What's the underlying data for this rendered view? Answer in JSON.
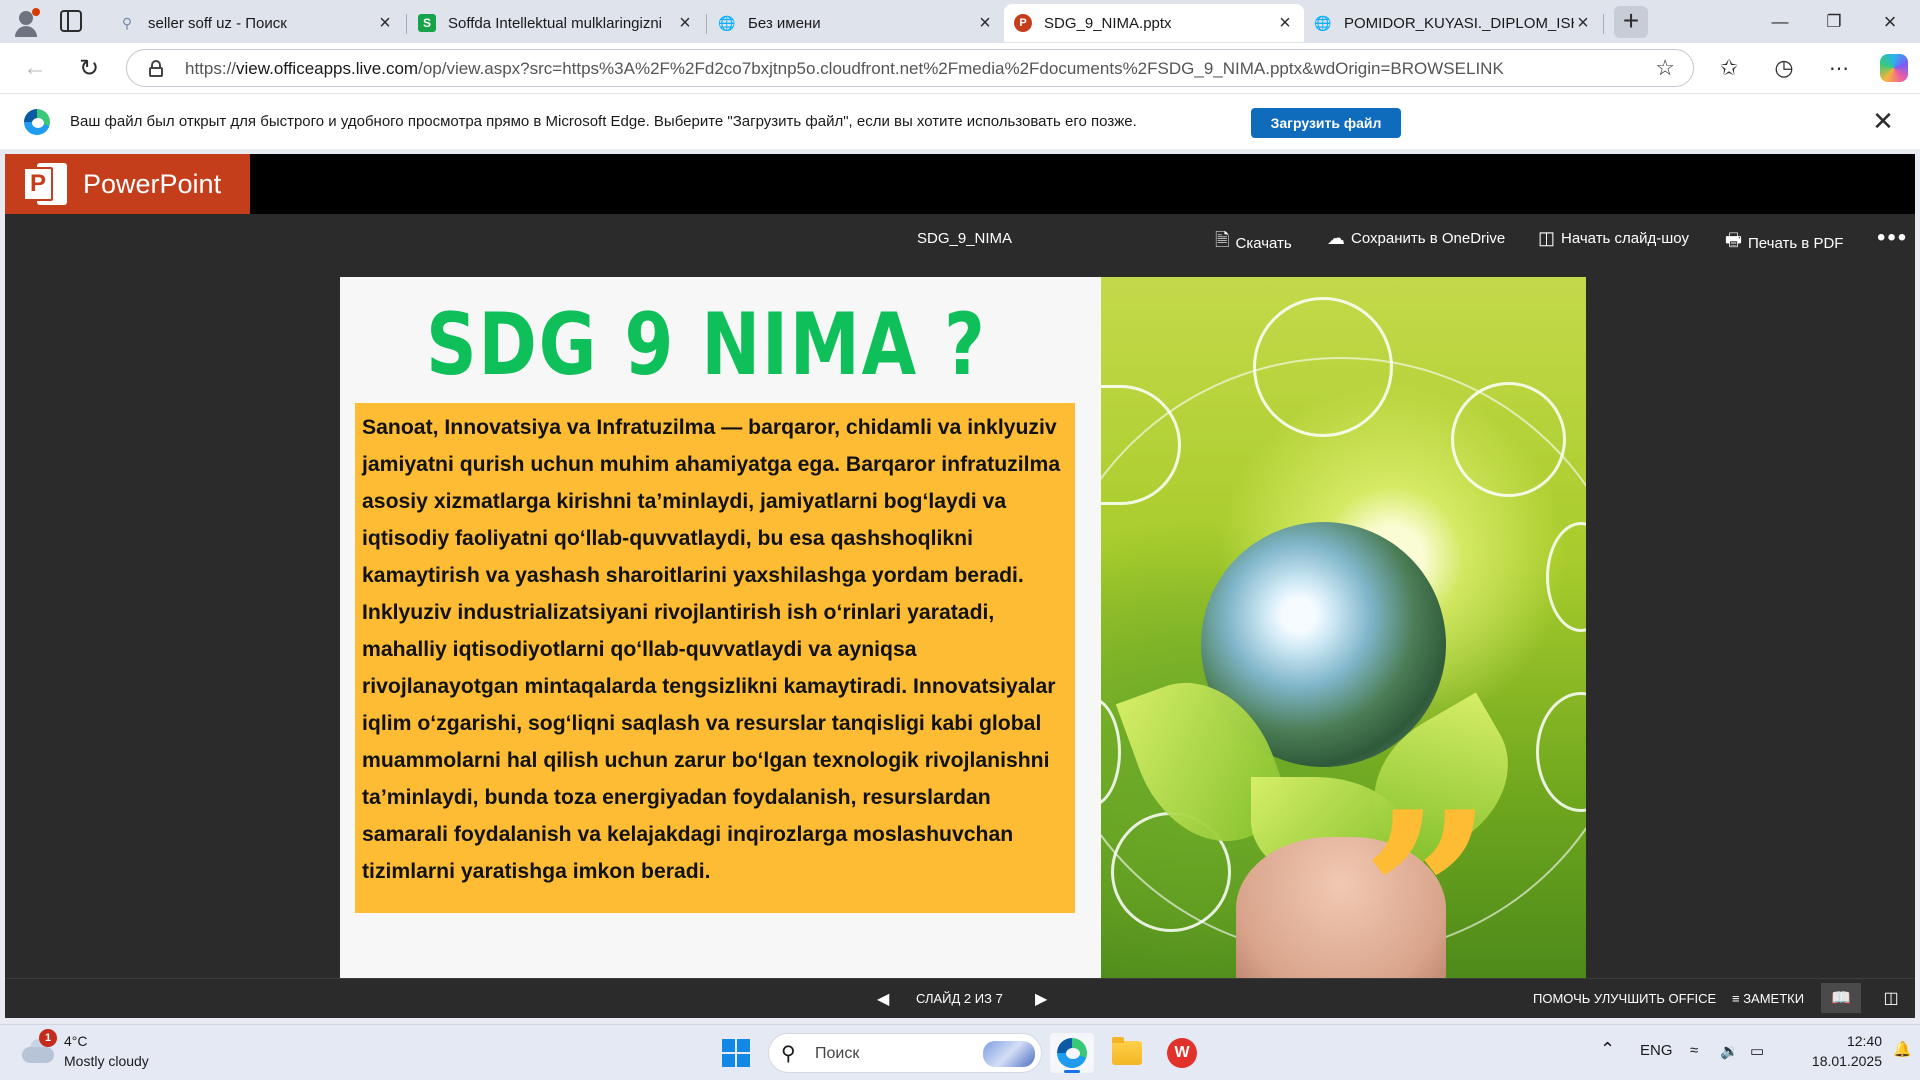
{
  "browser": {
    "tabs": [
      {
        "title": "seller soff uz - Поиск",
        "icon": "search-icon",
        "active": false
      },
      {
        "title": "Soffda Intellektual mulklaringizni",
        "icon": "soff-icon",
        "active": false
      },
      {
        "title": "Без имени",
        "icon": "globe-icon",
        "active": false
      },
      {
        "title": "SDG_9_NIMA.pptx",
        "icon": "powerpoint-icon",
        "active": true
      },
      {
        "title": "POMIDOR_KUYASI._DIPLOM_ISHI",
        "icon": "globe-icon",
        "active": false
      }
    ],
    "url_prefix": "https://",
    "url_host": "view.officeapps.live.com",
    "url_rest": "/op/view.aspx?src=https%3A%2F%2Fd2co7bxjtnp5o.cloudfront.net%2Fmedia%2Fdocuments%2FSDG_9_NIMA.pptx&wdOrigin=BROWSELINK"
  },
  "infobar": {
    "message": "Ваш файл был открыт для быстрого и удобного просмотра прямо в Microsoft Edge. Выберите \"Загрузить файл\", если вы хотите использовать его позже.",
    "button": "Загрузить файл"
  },
  "ppt": {
    "app_name": "PowerPoint",
    "doc_title": "SDG_9_NIMA",
    "commands": {
      "download": "Скачать",
      "save_onedrive": "Сохранить в OneDrive",
      "slideshow": "Начать слайд-шоу",
      "print_pdf": "Печать в PDF"
    },
    "slide": {
      "title": "SDG 9 NIMA ?",
      "body": "Sanoat, Innovatsiya va Infratuzilma — barqaror, chidamli va inklyuziv jamiyatni qurish uchun muhim ahamiyatga ega. Barqaror infratuzilma asosiy xizmatlarga kirishni ta’minlaydi, jamiyatlarni bog‘laydi va iqtisodiy faoliyatni qo‘llab-quvvatlaydi, bu esa qashshoqlikni kamaytirish va yashash sharoitlarini yaxshilashga yordam beradi. Inklyuziv industrializatsiyani rivojlantirish ish o‘rinlari yaratadi, mahalliy iqtisodiyotlarni qo‘llab-quvvatlaydi va ayniqsa rivojlanayotgan mintaqalarda tengsizlikni kamaytiradi. Innovatsiyalar iqlim o‘zgarishi, sog‘liqni saqlash va resurslar tanqisligi kabi global muammolarni hal qilish uchun zarur bo‘lgan texnologik rivojlanishni ta’minlaydi, bunda toza energiyadan foydalanish, resurslardan samarali foydalanish va kelajakdagi inqirozlarga moslashuvchan tizimlarni yaratishga imkon beradi.",
      "box_color": "#FDBC33",
      "title_color": "#0FBF5A"
    },
    "footer": {
      "slide_counter": "СЛАЙД 2 ИЗ 7",
      "help": "ПОМОЧЬ УЛУЧШИТЬ OFFICE",
      "notes": "ЗАМЕТКИ"
    }
  },
  "taskbar": {
    "weather_temp": "4°C",
    "weather_desc": "Mostly cloudy",
    "weather_badge": "1",
    "search_placeholder": "Поиск",
    "language": "ENG",
    "time": "12:40",
    "date": "18.01.2025"
  }
}
